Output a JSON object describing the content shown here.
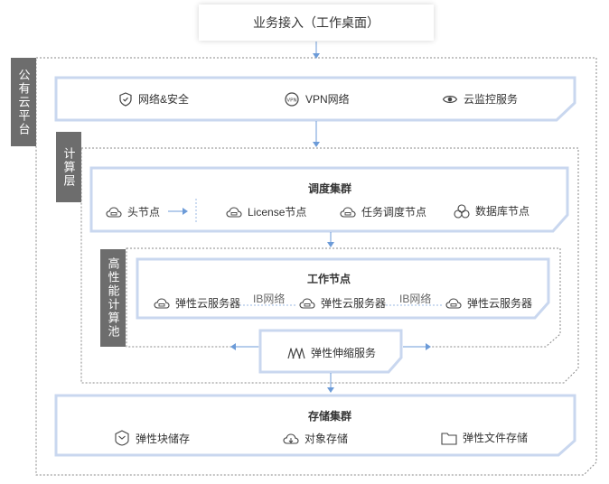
{
  "top": {
    "label": "业务接入（工作桌面）"
  },
  "public_cloud": {
    "label": "公有云平台",
    "network": [
      {
        "icon": "shield-icon",
        "label": "网络&安全"
      },
      {
        "icon": "vpn-icon",
        "label": "VPN网络"
      },
      {
        "icon": "eye-icon",
        "label": "云监控服务"
      }
    ]
  },
  "compute": {
    "label": "计算层",
    "scheduling": {
      "title": "调度集群",
      "nodes": [
        {
          "icon": "cloud-icon",
          "label": "头节点"
        },
        {
          "icon": "cloud-icon",
          "label": "License节点"
        },
        {
          "icon": "cloud-icon",
          "label": "任务调度节点"
        },
        {
          "icon": "database-icon",
          "label": "数据库节点"
        }
      ]
    },
    "hpc": {
      "label": "高性能计算池",
      "work": {
        "title": "工作节点",
        "servers": [
          "弹性云服务器",
          "弹性云服务器",
          "弹性云服务器"
        ],
        "links": [
          "IB网络",
          "IB网络"
        ]
      }
    },
    "scaling": {
      "icon": "scaling-icon",
      "label": "弹性伸缩服务"
    }
  },
  "storage": {
    "title": "存储集群",
    "items": [
      {
        "icon": "block-storage-icon",
        "label": "弹性块储存"
      },
      {
        "icon": "object-storage-icon",
        "label": "对象存储"
      },
      {
        "icon": "folder-icon",
        "label": "弹性文件存储"
      }
    ]
  }
}
